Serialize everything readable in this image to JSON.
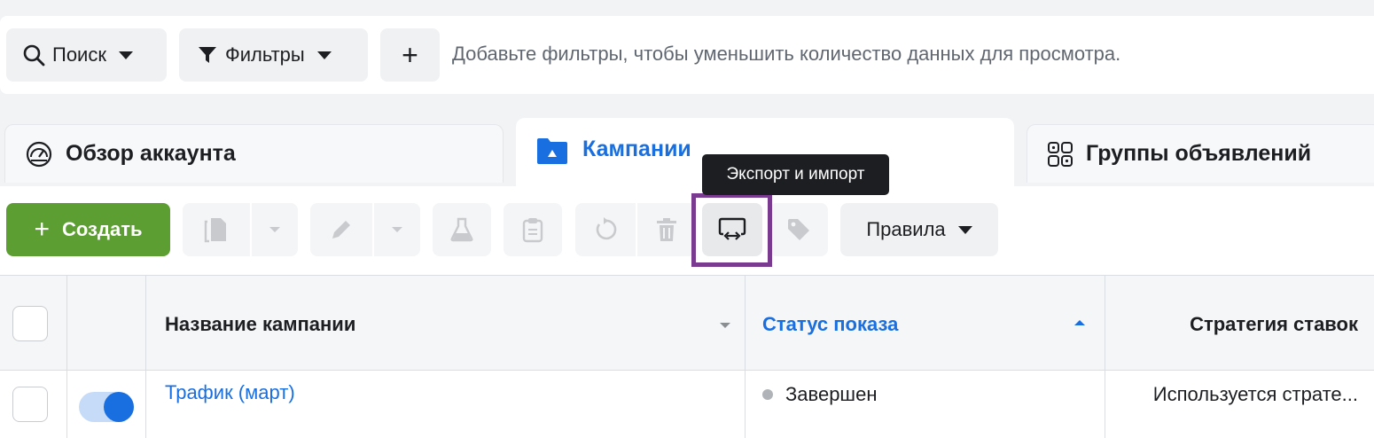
{
  "filter_bar": {
    "search_label": "Поиск",
    "filters_label": "Фильтры",
    "add_label": "+",
    "hint": "Добавьте фильтры, чтобы уменьшить количество данных для просмотра."
  },
  "tabs": [
    {
      "label": "Обзор аккаунта",
      "icon": "dashboard-gauge-icon",
      "active": false
    },
    {
      "label": "Кампании",
      "icon": "folder-icon",
      "active": true
    },
    {
      "label": "Группы объявлений",
      "icon": "grid-icon",
      "active": false
    }
  ],
  "toolbar": {
    "create_label": "Создать",
    "create_color": "#5c9e31",
    "rules_label": "Правила",
    "tooltip": "Экспорт и импорт",
    "highlight_color": "#7a3a8f"
  },
  "table": {
    "columns": [
      "Название кампании",
      "Статус показа",
      "Стратегия ставок"
    ],
    "sorted_column": "Статус показа",
    "rows": [
      {
        "name": "Трафик (март)",
        "status": "Завершен",
        "strategy": "Используется страте...",
        "enabled": true
      }
    ]
  },
  "colors": {
    "accent": "#1a6fe0",
    "text": "#1c1e21",
    "muted": "#606770"
  }
}
